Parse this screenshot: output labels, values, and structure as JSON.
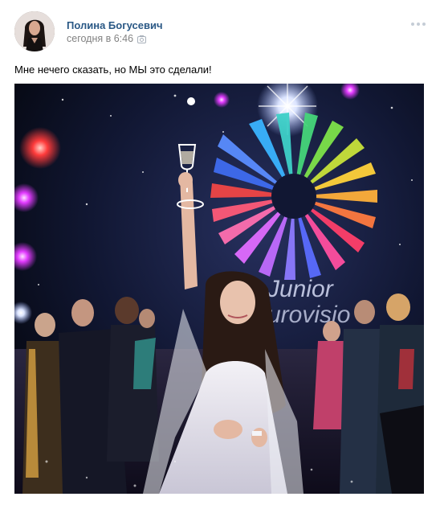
{
  "post": {
    "author": {
      "name": "Полина Богусевич",
      "avatar_icon": "avatar-photo"
    },
    "timestamp": "сегодня в 6:46",
    "text": "Мне нечего сказать, но МЫ это сделали!",
    "photo": {
      "logo_text": "Junior Eurovision",
      "accent_color": "#2a5885"
    }
  },
  "icons": {
    "camera": "camera-icon",
    "more": "more-icon"
  },
  "colors": {
    "name_link": "#2a5885",
    "meta_text": "#828282",
    "body_text": "#000000",
    "background": "#ffffff"
  }
}
